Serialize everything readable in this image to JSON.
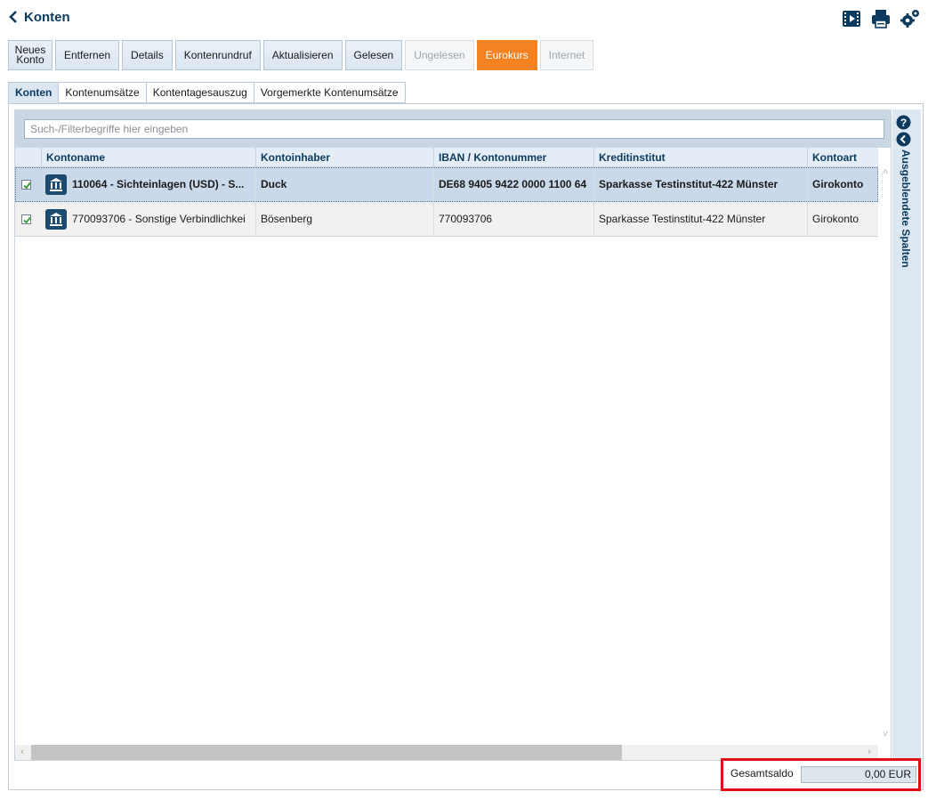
{
  "window": {
    "title": "Konten"
  },
  "top_icons": [
    "film-icon",
    "printer-icon",
    "gears-icon"
  ],
  "toolbar": {
    "new_account": "Neues\nKonto",
    "remove": "Entfernen",
    "details": "Details",
    "account_poll": "Kontenrundruf",
    "refresh": "Aktualisieren",
    "read": "Gelesen",
    "unread": "Ungelesen",
    "euro_rate": "Eurokurs",
    "internet": "Internet"
  },
  "tabs": [
    "Konten",
    "Kontenumsätze",
    "Kontentagesauszug",
    "Vorgemerkte Kontenumsätze"
  ],
  "search": {
    "placeholder": "Such-/Filterbegriffe hier eingeben",
    "value": ""
  },
  "table": {
    "columns": [
      "Kontoname",
      "Kontoinhaber",
      "IBAN / Kontonummer",
      "Kreditinstitut",
      "Kontoart"
    ],
    "rows": [
      {
        "checked": true,
        "selected": true,
        "name": "110064 - Sichteinlagen (USD) - S...",
        "holder": "Duck",
        "iban": "DE68 9405 9422 0000 1100 64",
        "bank": "Sparkasse Testinstitut-422 Münster",
        "type": "Girokonto"
      },
      {
        "checked": true,
        "selected": false,
        "name": "770093706 - Sonstige Verbindlichkei",
        "holder": "Bösenberg",
        "iban": "770093706",
        "bank": "Sparkasse Testinstitut-422 Münster",
        "type": "Girokonto"
      }
    ]
  },
  "side_panel": {
    "label": "Ausgeblendete Spalten"
  },
  "footer": {
    "total_label": "Gesamtsaldo",
    "total_value": "0,00 EUR"
  },
  "colors": {
    "accent": "#f58220",
    "brand": "#0b3a5e",
    "highlight": "#e0101a"
  }
}
